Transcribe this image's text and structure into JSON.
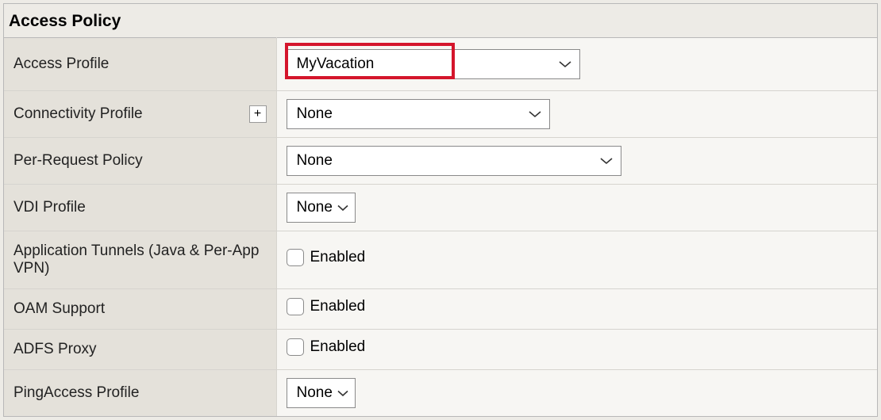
{
  "section_title": "Access Policy",
  "rows": {
    "access_profile": {
      "label": "Access Profile",
      "value": "MyVacation"
    },
    "connectivity_profile": {
      "label": "Connectivity Profile",
      "value": "None",
      "add_label": "+"
    },
    "per_request_policy": {
      "label": "Per-Request Policy",
      "value": "None"
    },
    "vdi_profile": {
      "label": "VDI Profile",
      "value": "None"
    },
    "app_tunnels": {
      "label": "Application Tunnels (Java & Per-App VPN)",
      "checkbox_label": "Enabled"
    },
    "oam_support": {
      "label": "OAM Support",
      "checkbox_label": "Enabled"
    },
    "adfs_proxy": {
      "label": "ADFS Proxy",
      "checkbox_label": "Enabled"
    },
    "pingaccess_profile": {
      "label": "PingAccess Profile",
      "value": "None"
    }
  }
}
